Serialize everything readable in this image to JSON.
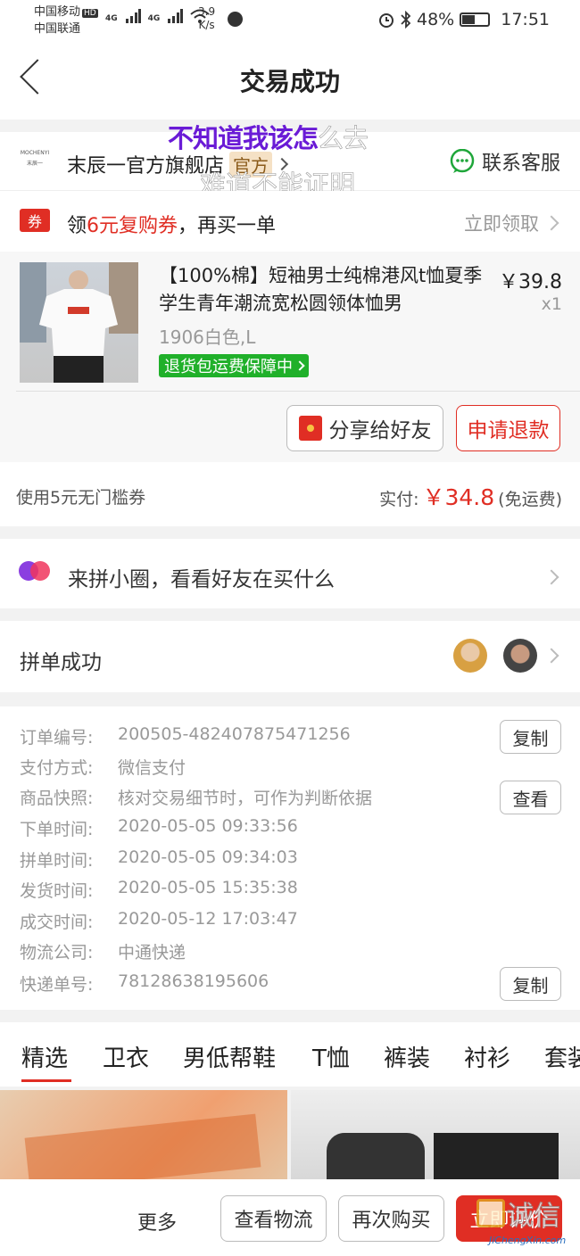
{
  "status": {
    "carrier1": "中国移动",
    "hd": "HD",
    "carrier2": "中国联通",
    "net1": "4G",
    "net2": "4G",
    "speed_value": "3.9",
    "speed_unit": "K/s",
    "battery": "48%",
    "time": "17:51"
  },
  "nav": {
    "title": "交易成功"
  },
  "overlay": {
    "line1_a": "不知道我该怎",
    "line1_b": "么去",
    "line2": "难道不能证明"
  },
  "store": {
    "logo_text": "MOCHENYI",
    "logo_sub": "末辰一",
    "name": "末辰一官方旗舰店",
    "badge": "官方",
    "contact": "联系客服"
  },
  "coupon": {
    "icon": "券",
    "pre": "领",
    "amount": "6元复购券",
    "post": "，再买一单",
    "action": "立即领取"
  },
  "product": {
    "title": "【100%棉】短袖男士纯棉港风t恤夏季学生青年潮流宽松圆领体恤男",
    "sku": "1906白色,L",
    "guarantee": "退货包运费保障中",
    "price": "￥39.8",
    "qty": "x1",
    "share_button": "分享给好友",
    "refund_button": "申请退款"
  },
  "payment": {
    "coupon_used": "使用5元无门槛券",
    "paid_label": "实付:",
    "paid_amount": "￥34.8",
    "shipping": "(免运费)"
  },
  "circle": {
    "text": "来拼小圈，看看好友在买什么"
  },
  "group": {
    "title": "拼单成功"
  },
  "order": {
    "rows": [
      {
        "label": "订单编号:",
        "value": "200505-482407875471256"
      },
      {
        "label": "支付方式:",
        "value": "微信支付"
      },
      {
        "label": "商品快照:",
        "value": "核对交易细节时，可作为判断依据"
      },
      {
        "label": "下单时间:",
        "value": "2020-05-05 09:33:56"
      },
      {
        "label": "拼单时间:",
        "value": "2020-05-05 09:34:03"
      },
      {
        "label": "发货时间:",
        "value": "2020-05-05 15:35:38"
      },
      {
        "label": "成交时间:",
        "value": "2020-05-12 17:03:47"
      },
      {
        "label": "物流公司:",
        "value": "中通快递"
      },
      {
        "label": "快递单号:",
        "value": "78128638195606"
      }
    ],
    "copy_label": "复制",
    "view_label": "查看"
  },
  "tabs": [
    "精选",
    "卫衣",
    "男低帮鞋",
    "T恤",
    "裤装",
    "衬衫",
    "套装"
  ],
  "bottom": {
    "more": "更多",
    "logistics": "查看物流",
    "rebuy": "再次购买",
    "review": "立即评价"
  },
  "watermark": {
    "text": "诚信",
    "url": "JiChengXin.com"
  },
  "colors": {
    "accent": "#e02e24",
    "green": "#20b02a",
    "purple": "#6a1bd6"
  }
}
